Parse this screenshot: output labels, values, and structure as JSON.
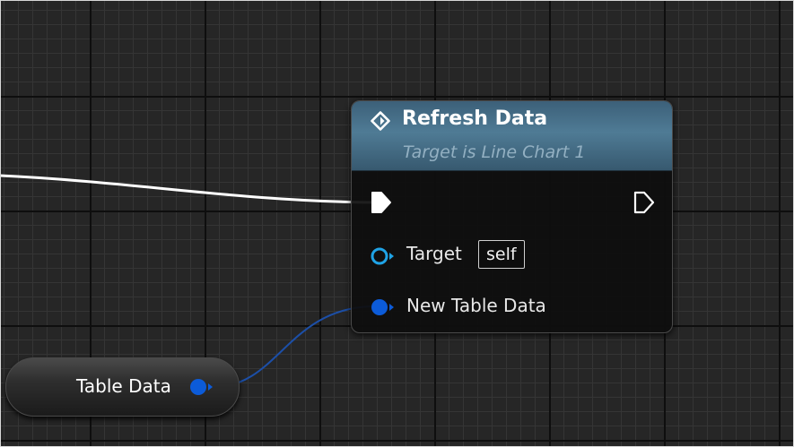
{
  "function_node": {
    "title": "Refresh Data",
    "subtitle": "Target is Line Chart 1",
    "icon": "function-diamond-icon",
    "exec_in_icon": "exec-pin-filled-icon",
    "exec_out_icon": "exec-pin-hollow-icon",
    "inputs": [
      {
        "label": "Target",
        "icon": "object-pin-hollow-icon",
        "default_value": "self"
      },
      {
        "label": "New Table Data",
        "icon": "struct-pin-filled-icon"
      }
    ]
  },
  "variable_node": {
    "label": "Table Data",
    "pin_icon": "struct-pin-filled-icon"
  },
  "colors": {
    "header_blue": "#4f7b95",
    "exec_wire": "#ffffff",
    "data_pin_blue": "#0c5bd8",
    "object_pin_blue": "#1fa3e6",
    "data_wire": "#1c4fa8"
  }
}
